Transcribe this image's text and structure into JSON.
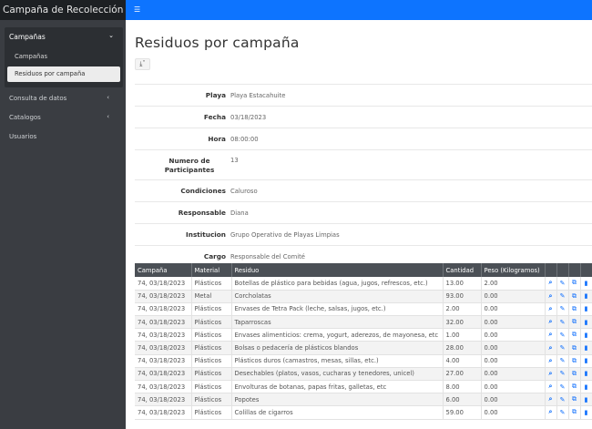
{
  "sidebar": {
    "brand": "Campaña de Recolección",
    "group_label": "Campañas",
    "sub_items": [
      {
        "label": "Campañas"
      },
      {
        "label": "Residuos por campaña"
      }
    ],
    "items": [
      {
        "label": "Consulta de datos"
      },
      {
        "label": "Catalogos"
      },
      {
        "label": "Usuarios"
      }
    ]
  },
  "topbar": {
    "menu_icon": "hamburger-icon"
  },
  "main": {
    "title": "Residuos por campaña",
    "download_icon": "download-icon",
    "details": [
      {
        "label": "Playa",
        "value": "Playa Estacahuite"
      },
      {
        "label": "Fecha",
        "value": "03/18/2023"
      },
      {
        "label": "Hora",
        "value": "08:00:00"
      },
      {
        "label": "Numero de Participantes",
        "value": "13"
      },
      {
        "label": "Condiciones",
        "value": "Caluroso"
      },
      {
        "label": "Responsable",
        "value": "Diana"
      },
      {
        "label": "Institucion",
        "value": "Grupo Operativo de Playas Limpias"
      },
      {
        "label": "Cargo",
        "value": "Responsable del Comité"
      }
    ]
  },
  "table": {
    "headers": [
      "Campaña",
      "Material",
      "Residuo",
      "Cantidad",
      "Peso (Kilogramos)",
      "",
      "",
      "",
      ""
    ],
    "rows": [
      [
        "74, 03/18/2023",
        "Plásticos",
        "Botellas de plástico para bebidas (agua, jugos, refrescos, etc.)",
        "13.00",
        "2.00"
      ],
      [
        "74, 03/18/2023",
        "Metal",
        "Corcholatas",
        "93.00",
        "0.00"
      ],
      [
        "74, 03/18/2023",
        "Plásticos",
        "Envases de Tetra Pack (leche, salsas, jugos, etc.)",
        "2.00",
        "0.00"
      ],
      [
        "74, 03/18/2023",
        "Plásticos",
        "Taparroscas",
        "32.00",
        "0.00"
      ],
      [
        "74, 03/18/2023",
        "Plásticos",
        "Envases alimenticios: crema, yogurt, aderezos, de mayonesa, etc",
        "1.00",
        "0.00"
      ],
      [
        "74, 03/18/2023",
        "Plásticos",
        "Bolsas o pedacería de plásticos blandos",
        "28.00",
        "0.00"
      ],
      [
        "74, 03/18/2023",
        "Plásticos",
        "Plásticos duros (camastros, mesas, sillas, etc.)",
        "4.00",
        "0.00"
      ],
      [
        "74, 03/18/2023",
        "Plásticos",
        "Desechables (platos, vasos, cucharas y tenedores, unicel)",
        "27.00",
        "0.00"
      ],
      [
        "74, 03/18/2023",
        "Plásticos",
        "Envolturas de botanas, papas fritas, galletas, etc",
        "8.00",
        "0.00"
      ],
      [
        "74, 03/18/2023",
        "Plásticos",
        "Popotes",
        "6.00",
        "0.00"
      ],
      [
        "74, 03/18/2023",
        "Plásticos",
        "Colillas de cigarros",
        "59.00",
        "0.00"
      ]
    ],
    "row_action_icons": [
      "view-icon",
      "edit-icon",
      "copy-icon",
      "delete-icon"
    ]
  },
  "colors": {
    "topbar": "#0d74ff",
    "sidebar": "#3a3d42",
    "table_header": "#4b5056",
    "action_icons": "#0d6efd"
  }
}
